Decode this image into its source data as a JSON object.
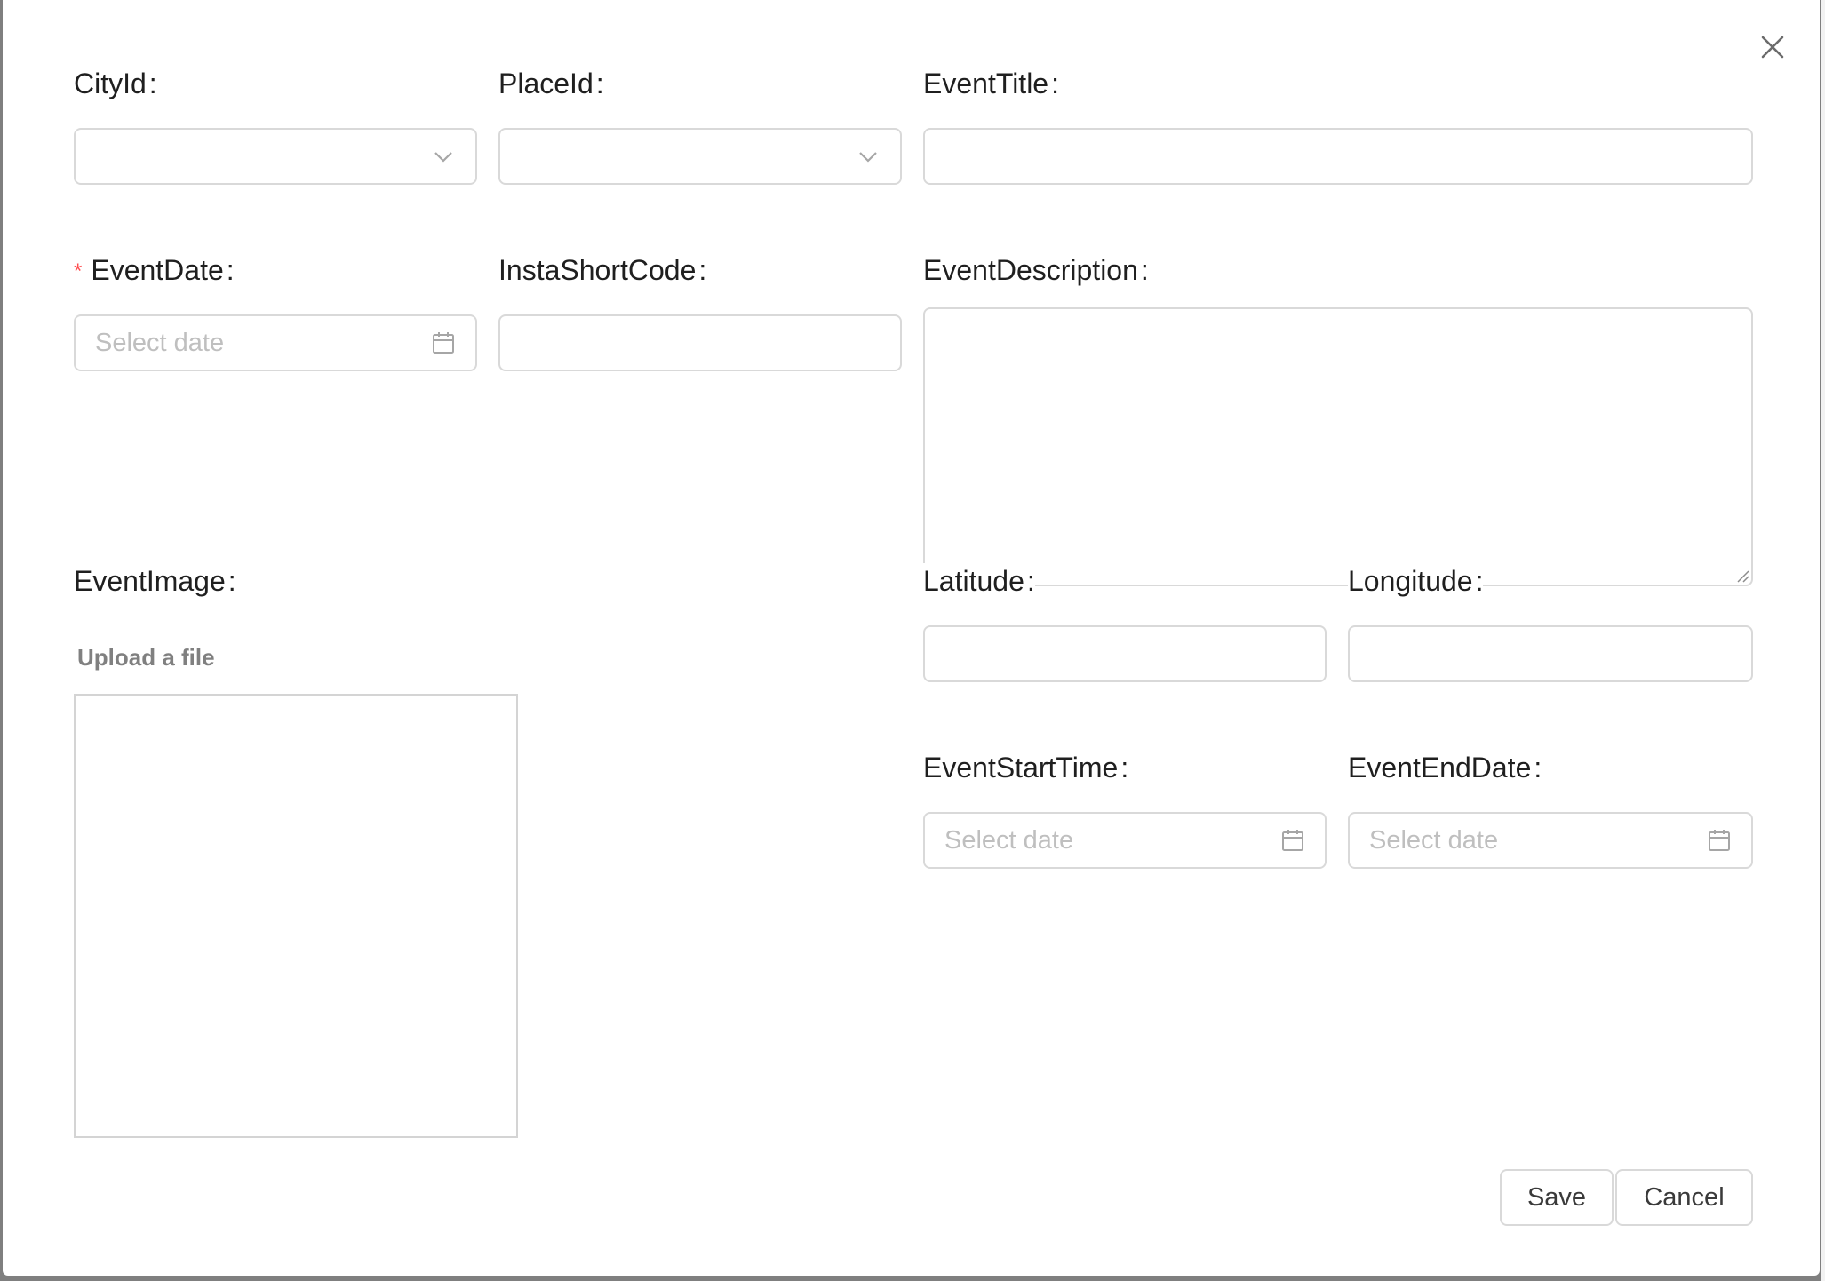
{
  "modal": {
    "close_icon": "close-icon"
  },
  "form": {
    "city_id": {
      "label": "CityId",
      "colon": ":",
      "value": "",
      "icon": "chevron-down-icon"
    },
    "place_id": {
      "label": "PlaceId",
      "colon": ":",
      "value": "",
      "icon": "chevron-down-icon"
    },
    "event_title": {
      "label": "EventTitle",
      "colon": ":",
      "value": ""
    },
    "event_date": {
      "required_mark": "*",
      "label": "EventDate",
      "colon": ":",
      "placeholder": "Select date",
      "icon": "calendar-icon"
    },
    "insta_short_code": {
      "label": "InstaShortCode",
      "colon": ":",
      "value": ""
    },
    "event_description": {
      "label": "EventDescription",
      "colon": ":",
      "value": ""
    },
    "event_image": {
      "label": "EventImage",
      "colon": ":",
      "upload_text": "Upload a file"
    },
    "latitude": {
      "label": "Latitude",
      "colon": ":",
      "value": ""
    },
    "longitude": {
      "label": "Longitude",
      "colon": ":",
      "value": ""
    },
    "event_start_time": {
      "label": "EventStartTime",
      "colon": ":",
      "placeholder": "Select date",
      "icon": "calendar-icon"
    },
    "event_end_date": {
      "label": "EventEndDate",
      "colon": ":",
      "placeholder": "Select date",
      "icon": "calendar-icon"
    }
  },
  "footer": {
    "save_label": "Save",
    "cancel_label": "Cancel"
  },
  "colors": {
    "required": "#ff4d4f",
    "border": "#d9d9d9",
    "placeholder": "#bfbfbf",
    "label": "#1f1f1f"
  }
}
